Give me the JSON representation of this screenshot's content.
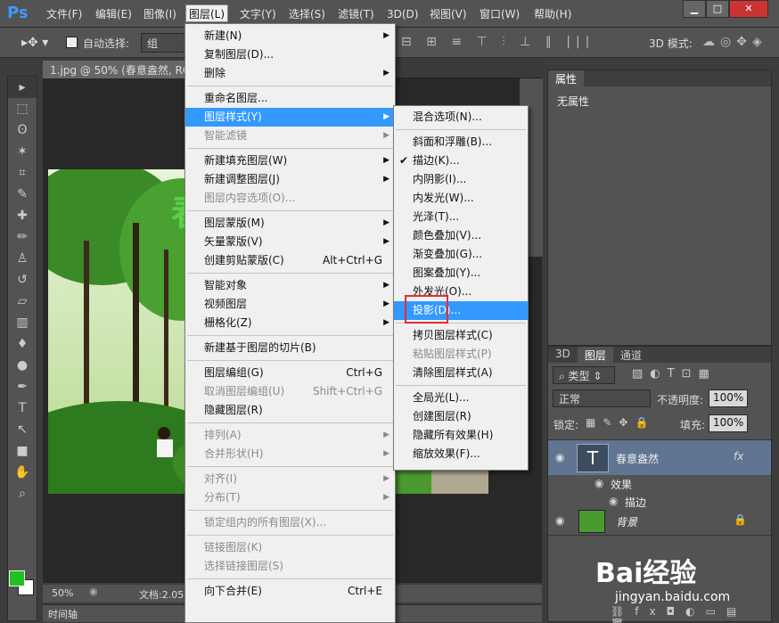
{
  "app": {
    "logo": "Ps"
  },
  "menubar": {
    "items": [
      "文件(F)",
      "编辑(E)",
      "图像(I)",
      "图层(L)",
      "文字(Y)",
      "选择(S)",
      "滤镜(T)",
      "3D(D)",
      "视图(V)",
      "窗口(W)",
      "帮助(H)"
    ],
    "active": "图层(L)"
  },
  "window_controls": {
    "minimize": "▁",
    "maximize": "□",
    "close": "✕"
  },
  "options_bar": {
    "auto_select_label": "自动选择:",
    "auto_select_value": "组",
    "mode_label": "3D 模式:"
  },
  "document": {
    "tab_title": "1.jpg @ 50% (春意盎然, RGB",
    "zoom": "50%",
    "doc_info": "文档:2.05",
    "timeline_label": "时间轴",
    "photo_text_fragment": "春"
  },
  "layer_menu": {
    "groups": [
      [
        {
          "label": "新建(N)",
          "arrow": true
        },
        {
          "label": "复制图层(D)..."
        },
        {
          "label": "删除",
          "arrow": true
        }
      ],
      [
        {
          "label": "重命名图层..."
        },
        {
          "label": "图层样式(Y)",
          "arrow": true,
          "highlight": true
        },
        {
          "label": "智能滤镜",
          "arrow": true,
          "disabled": true
        }
      ],
      [
        {
          "label": "新建填充图层(W)",
          "arrow": true
        },
        {
          "label": "新建调整图层(J)",
          "arrow": true
        },
        {
          "label": "图层内容选项(O)...",
          "disabled": true
        }
      ],
      [
        {
          "label": "图层蒙版(M)",
          "arrow": true
        },
        {
          "label": "矢量蒙版(V)",
          "arrow": true
        },
        {
          "label": "创建剪贴蒙版(C)",
          "shortcut": "Alt+Ctrl+G"
        }
      ],
      [
        {
          "label": "智能对象",
          "arrow": true
        },
        {
          "label": "视频图层",
          "arrow": true
        },
        {
          "label": "栅格化(Z)",
          "arrow": true
        }
      ],
      [
        {
          "label": "新建基于图层的切片(B)"
        }
      ],
      [
        {
          "label": "图层编组(G)",
          "shortcut": "Ctrl+G"
        },
        {
          "label": "取消图层编组(U)",
          "shortcut": "Shift+Ctrl+G",
          "disabled": true
        },
        {
          "label": "隐藏图层(R)"
        }
      ],
      [
        {
          "label": "排列(A)",
          "arrow": true,
          "disabled": true
        },
        {
          "label": "合并形状(H)",
          "arrow": true,
          "disabled": true
        }
      ],
      [
        {
          "label": "对齐(I)",
          "arrow": true,
          "disabled": true
        },
        {
          "label": "分布(T)",
          "arrow": true,
          "disabled": true
        }
      ],
      [
        {
          "label": "锁定组内的所有图层(X)...",
          "disabled": true
        }
      ],
      [
        {
          "label": "链接图层(K)",
          "disabled": true
        },
        {
          "label": "选择链接图层(S)",
          "disabled": true
        }
      ],
      [
        {
          "label": "向下合并(E)",
          "shortcut": "Ctrl+E"
        }
      ]
    ]
  },
  "style_submenu": {
    "groups": [
      [
        {
          "label": "混合选项(N)..."
        }
      ],
      [
        {
          "label": "斜面和浮雕(B)..."
        },
        {
          "label": "描边(K)...",
          "checked": true
        },
        {
          "label": "内阴影(I)..."
        },
        {
          "label": "内发光(W)..."
        },
        {
          "label": "光泽(T)..."
        },
        {
          "label": "颜色叠加(V)..."
        },
        {
          "label": "渐变叠加(G)..."
        },
        {
          "label": "图案叠加(Y)..."
        },
        {
          "label": "外发光(O)..."
        },
        {
          "label": "投影(D)...",
          "highlight": true
        }
      ],
      [
        {
          "label": "拷贝图层样式(C)"
        },
        {
          "label": "粘贴图层样式(P)",
          "disabled": true
        },
        {
          "label": "清除图层样式(A)"
        }
      ],
      [
        {
          "label": "全局光(L)..."
        },
        {
          "label": "创建图层(R)"
        },
        {
          "label": "隐藏所有效果(H)"
        },
        {
          "label": "缩放效果(F)..."
        }
      ]
    ]
  },
  "properties_panel": {
    "tab": "属性",
    "content": "无属性"
  },
  "layers_panel": {
    "tabs": [
      "3D",
      "图层",
      "通道"
    ],
    "active_tab": "图层",
    "filter_label": "类型",
    "blend_mode": "正常",
    "opacity_label": "不透明度:",
    "opacity_value": "100%",
    "lock_label": "锁定:",
    "fill_label": "填充:",
    "fill_value": "100%",
    "layers": [
      {
        "name": "春意盎然",
        "type": "text",
        "thumb": "T",
        "fx": "fx",
        "selected": true
      },
      {
        "name": "效果",
        "type": "effects-header"
      },
      {
        "name": "描边",
        "type": "effect"
      },
      {
        "name": "背景",
        "type": "image",
        "locked": true
      }
    ]
  },
  "watermark": {
    "logo": "Bai经验",
    "url": "jingyan.baidu.com"
  },
  "colors": {
    "foreground": "#22c022",
    "background": "#ffffff",
    "highlight": "#3399ff",
    "annotation": "#e03030"
  }
}
